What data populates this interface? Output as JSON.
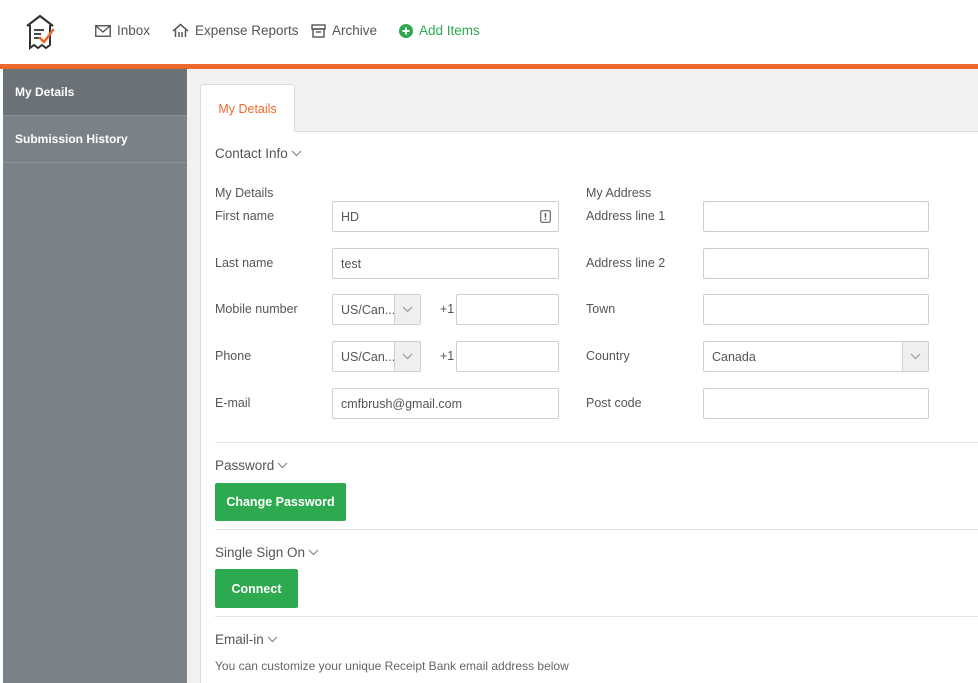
{
  "nav": {
    "inbox": "Inbox",
    "expense_reports": "Expense Reports",
    "archive": "Archive",
    "add_items": "Add Items"
  },
  "sidebar": {
    "items": [
      {
        "label": "My Details",
        "active": true
      },
      {
        "label": "Submission History",
        "active": false
      }
    ]
  },
  "tab": {
    "label": "My Details"
  },
  "contact": {
    "title": "Contact Info",
    "my_details_heading": "My Details",
    "my_address_heading": "My Address",
    "first_name_label": "First name",
    "first_name_value": "HD",
    "last_name_label": "Last name",
    "last_name_value": "test",
    "mobile_label": "Mobile number",
    "mobile_country": "US/Can...",
    "mobile_prefix": "+1",
    "mobile_value": "",
    "phone_label": "Phone",
    "phone_country": "US/Can...",
    "phone_prefix": "+1",
    "phone_value": "",
    "email_label": "E-mail",
    "email_value": "cmfbrush@gmail.com",
    "address1_label": "Address line 1",
    "address1_value": "",
    "address2_label": "Address line 2",
    "address2_value": "",
    "town_label": "Town",
    "town_value": "",
    "country_label": "Country",
    "country_value": "Canada",
    "postcode_label": "Post code",
    "postcode_value": ""
  },
  "password": {
    "title": "Password",
    "button": "Change Password"
  },
  "sso": {
    "title": "Single Sign On",
    "button": "Connect"
  },
  "emailin": {
    "title": "Email-in",
    "hint": "You can customize your unique Receipt Bank email address below"
  },
  "colors": {
    "accent": "#ec6a2d",
    "green": "#2daa4f",
    "sidebar": "#7a8288"
  }
}
